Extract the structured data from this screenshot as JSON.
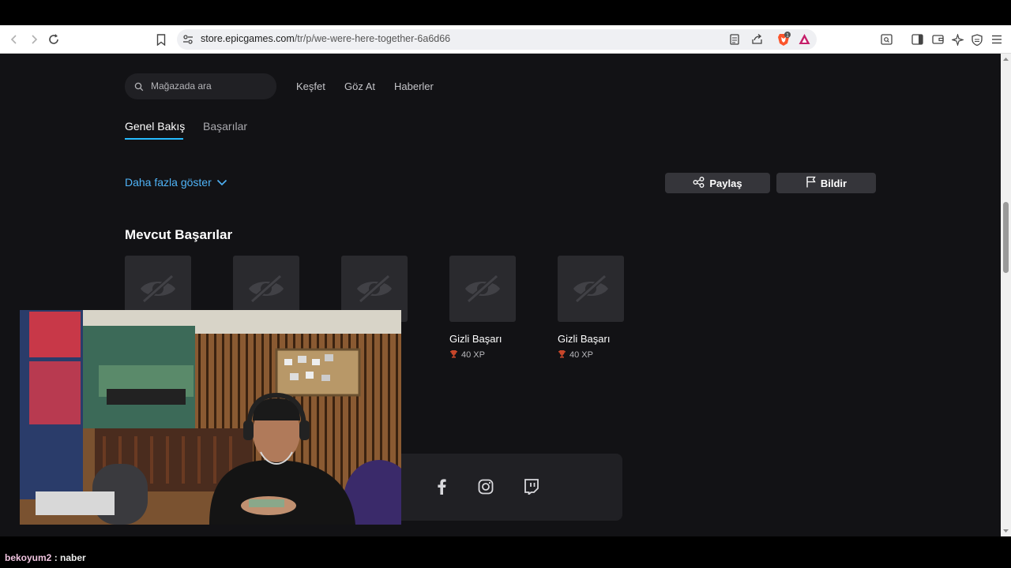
{
  "browser": {
    "url_domain": "store.epicgames.com",
    "url_path": "/tr/p/we-were-here-together-6a6d66",
    "brave_badge_count": "1"
  },
  "store": {
    "search_placeholder": "Mağazada ara",
    "nav": [
      "Keşfet",
      "Göz At",
      "Haberler"
    ],
    "tabs": [
      {
        "label": "Genel Bakış",
        "active": true
      },
      {
        "label": "Başarılar",
        "active": false
      }
    ],
    "show_more": "Daha fazla göster",
    "share_button": "Paylaş",
    "report_button": "Bildir",
    "achievements_title": "Mevcut Başarılar",
    "achievements": [
      {
        "name": "Gizli Başarı",
        "xp": "40 XP"
      },
      {
        "name": "Gizli Başarı",
        "xp": "40 XP"
      }
    ],
    "social_icons": [
      "facebook-icon",
      "instagram-icon",
      "twitch-icon"
    ]
  },
  "chat": {
    "username": "bekoyum2",
    "separator": " : ",
    "message": "naber"
  },
  "colors": {
    "page_bg": "#121215",
    "accent": "#26bbff",
    "link": "#4fb3f7",
    "card": "#2a2a2e",
    "trophy": "#c8462a"
  }
}
